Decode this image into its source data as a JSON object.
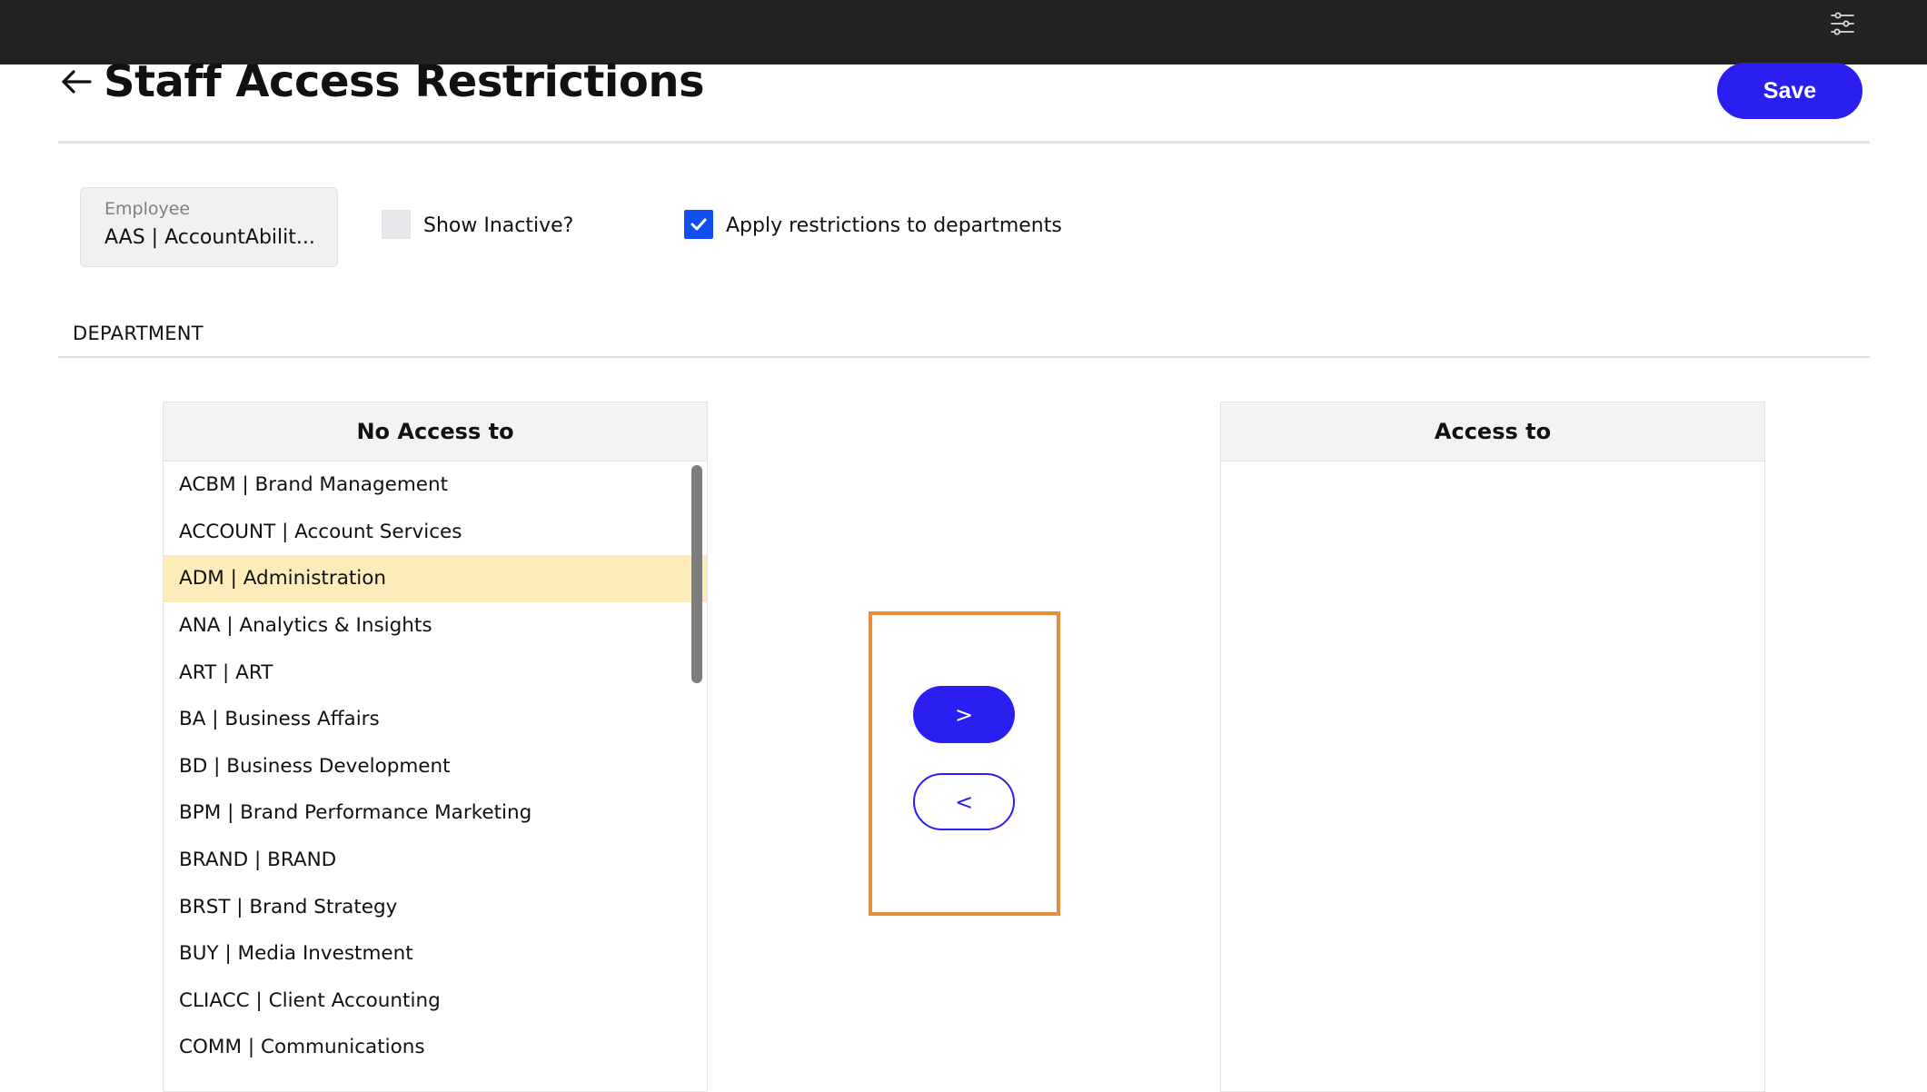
{
  "topbar": {
    "settings_icon": "sliders-icon"
  },
  "header": {
    "back_icon": "arrow-left-icon",
    "title": "Staff Access Restrictions",
    "save_label": "Save"
  },
  "filters": {
    "employee": {
      "label": "Employee",
      "value": "AAS | AccountAbilit..."
    },
    "show_inactive": {
      "label": "Show Inactive?",
      "checked": false
    },
    "apply_restrictions": {
      "label": "Apply restrictions to departments",
      "checked": true
    }
  },
  "section": {
    "label": "DEPARTMENT"
  },
  "no_access": {
    "header": "No Access to",
    "items": [
      "ACBM | Brand Management",
      "ACCOUNT | Account Services",
      "ADM | Administration",
      "ANA | Analytics & Insights",
      "ART | ART",
      "BA | Business Affairs",
      "BD | Business Development",
      "BPM | Brand Performance Marketing",
      "BRAND | BRAND",
      "BRST | Brand Strategy",
      "BUY | Media Investment",
      "CLIACC | Client Accounting",
      "COMM | Communications"
    ],
    "selected_item": "ADM | Administration"
  },
  "access": {
    "header": "Access to",
    "items": []
  },
  "transfer": {
    "move_right_label": ">",
    "move_left_label": "<"
  },
  "colors": {
    "accent": "#2a1ef0",
    "checkbox_checked": "#1150f0",
    "selection": "#fdebb9",
    "highlight_outline": "#e58e3c",
    "topbar": "#222222"
  }
}
